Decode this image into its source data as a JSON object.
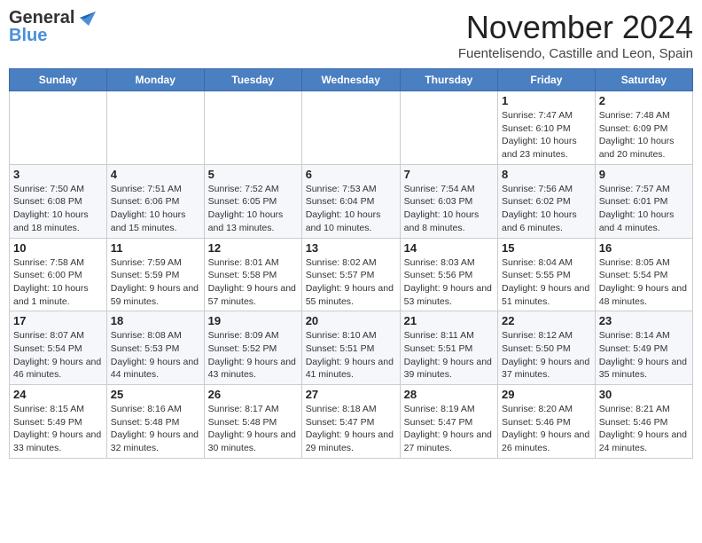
{
  "header": {
    "logo_general": "General",
    "logo_blue": "Blue",
    "month": "November 2024",
    "location": "Fuentelisendo, Castille and Leon, Spain"
  },
  "days_of_week": [
    "Sunday",
    "Monday",
    "Tuesday",
    "Wednesday",
    "Thursday",
    "Friday",
    "Saturday"
  ],
  "weeks": [
    [
      {
        "day": "",
        "info": ""
      },
      {
        "day": "",
        "info": ""
      },
      {
        "day": "",
        "info": ""
      },
      {
        "day": "",
        "info": ""
      },
      {
        "day": "",
        "info": ""
      },
      {
        "day": "1",
        "info": "Sunrise: 7:47 AM\nSunset: 6:10 PM\nDaylight: 10 hours and 23 minutes."
      },
      {
        "day": "2",
        "info": "Sunrise: 7:48 AM\nSunset: 6:09 PM\nDaylight: 10 hours and 20 minutes."
      }
    ],
    [
      {
        "day": "3",
        "info": "Sunrise: 7:50 AM\nSunset: 6:08 PM\nDaylight: 10 hours and 18 minutes."
      },
      {
        "day": "4",
        "info": "Sunrise: 7:51 AM\nSunset: 6:06 PM\nDaylight: 10 hours and 15 minutes."
      },
      {
        "day": "5",
        "info": "Sunrise: 7:52 AM\nSunset: 6:05 PM\nDaylight: 10 hours and 13 minutes."
      },
      {
        "day": "6",
        "info": "Sunrise: 7:53 AM\nSunset: 6:04 PM\nDaylight: 10 hours and 10 minutes."
      },
      {
        "day": "7",
        "info": "Sunrise: 7:54 AM\nSunset: 6:03 PM\nDaylight: 10 hours and 8 minutes."
      },
      {
        "day": "8",
        "info": "Sunrise: 7:56 AM\nSunset: 6:02 PM\nDaylight: 10 hours and 6 minutes."
      },
      {
        "day": "9",
        "info": "Sunrise: 7:57 AM\nSunset: 6:01 PM\nDaylight: 10 hours and 4 minutes."
      }
    ],
    [
      {
        "day": "10",
        "info": "Sunrise: 7:58 AM\nSunset: 6:00 PM\nDaylight: 10 hours and 1 minute."
      },
      {
        "day": "11",
        "info": "Sunrise: 7:59 AM\nSunset: 5:59 PM\nDaylight: 9 hours and 59 minutes."
      },
      {
        "day": "12",
        "info": "Sunrise: 8:01 AM\nSunset: 5:58 PM\nDaylight: 9 hours and 57 minutes."
      },
      {
        "day": "13",
        "info": "Sunrise: 8:02 AM\nSunset: 5:57 PM\nDaylight: 9 hours and 55 minutes."
      },
      {
        "day": "14",
        "info": "Sunrise: 8:03 AM\nSunset: 5:56 PM\nDaylight: 9 hours and 53 minutes."
      },
      {
        "day": "15",
        "info": "Sunrise: 8:04 AM\nSunset: 5:55 PM\nDaylight: 9 hours and 51 minutes."
      },
      {
        "day": "16",
        "info": "Sunrise: 8:05 AM\nSunset: 5:54 PM\nDaylight: 9 hours and 48 minutes."
      }
    ],
    [
      {
        "day": "17",
        "info": "Sunrise: 8:07 AM\nSunset: 5:54 PM\nDaylight: 9 hours and 46 minutes."
      },
      {
        "day": "18",
        "info": "Sunrise: 8:08 AM\nSunset: 5:53 PM\nDaylight: 9 hours and 44 minutes."
      },
      {
        "day": "19",
        "info": "Sunrise: 8:09 AM\nSunset: 5:52 PM\nDaylight: 9 hours and 43 minutes."
      },
      {
        "day": "20",
        "info": "Sunrise: 8:10 AM\nSunset: 5:51 PM\nDaylight: 9 hours and 41 minutes."
      },
      {
        "day": "21",
        "info": "Sunrise: 8:11 AM\nSunset: 5:51 PM\nDaylight: 9 hours and 39 minutes."
      },
      {
        "day": "22",
        "info": "Sunrise: 8:12 AM\nSunset: 5:50 PM\nDaylight: 9 hours and 37 minutes."
      },
      {
        "day": "23",
        "info": "Sunrise: 8:14 AM\nSunset: 5:49 PM\nDaylight: 9 hours and 35 minutes."
      }
    ],
    [
      {
        "day": "24",
        "info": "Sunrise: 8:15 AM\nSunset: 5:49 PM\nDaylight: 9 hours and 33 minutes."
      },
      {
        "day": "25",
        "info": "Sunrise: 8:16 AM\nSunset: 5:48 PM\nDaylight: 9 hours and 32 minutes."
      },
      {
        "day": "26",
        "info": "Sunrise: 8:17 AM\nSunset: 5:48 PM\nDaylight: 9 hours and 30 minutes."
      },
      {
        "day": "27",
        "info": "Sunrise: 8:18 AM\nSunset: 5:47 PM\nDaylight: 9 hours and 29 minutes."
      },
      {
        "day": "28",
        "info": "Sunrise: 8:19 AM\nSunset: 5:47 PM\nDaylight: 9 hours and 27 minutes."
      },
      {
        "day": "29",
        "info": "Sunrise: 8:20 AM\nSunset: 5:46 PM\nDaylight: 9 hours and 26 minutes."
      },
      {
        "day": "30",
        "info": "Sunrise: 8:21 AM\nSunset: 5:46 PM\nDaylight: 9 hours and 24 minutes."
      }
    ]
  ]
}
